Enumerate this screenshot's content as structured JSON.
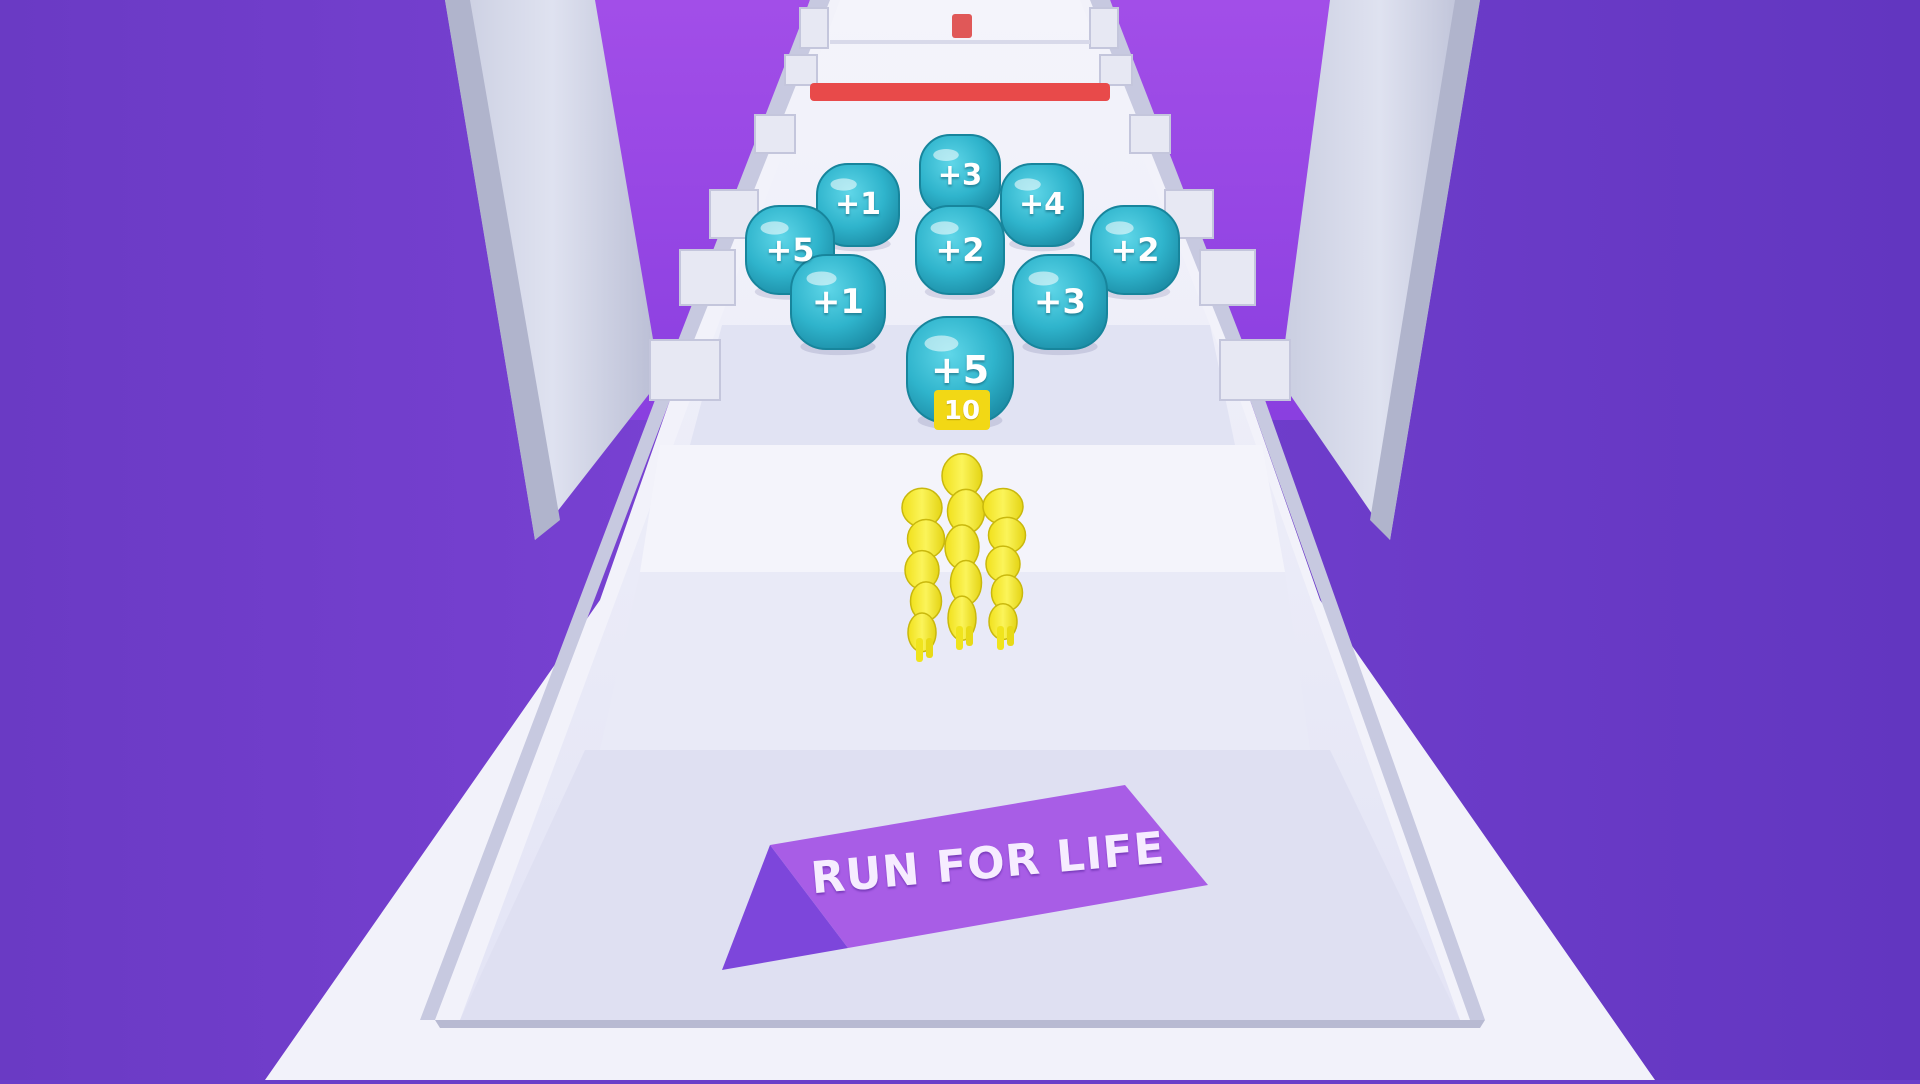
{
  "colors": {
    "wall_purple": "#6a3fc9",
    "wall_purple_light": "#8b4fe0",
    "track_white": "#eeeefa",
    "bubble_teal": "#2fb4cc",
    "crowd_yellow": "#f4ee2a",
    "ramp_purple": "#a85de6",
    "finish_red": "#e84a4a"
  },
  "crowd": {
    "count_label": "10",
    "runners": 3
  },
  "bubbles": [
    {
      "label": "+3"
    },
    {
      "label": "+1"
    },
    {
      "label": "+4"
    },
    {
      "label": "+5"
    },
    {
      "label": "+2"
    },
    {
      "label": "+2"
    },
    {
      "label": "+1"
    },
    {
      "label": "+3"
    },
    {
      "label": "+5"
    }
  ],
  "ramp": {
    "label": "RUN FOR LIFE"
  }
}
